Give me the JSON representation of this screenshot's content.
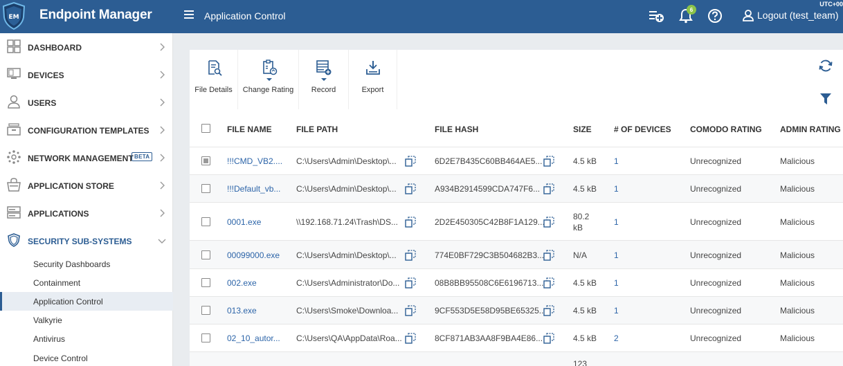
{
  "header": {
    "app_title": "Endpoint Manager",
    "logo_text": "EM",
    "page_title": "Application Control",
    "utc_label": "UTC+00",
    "notification_count": "6",
    "logout_label": "Logout (test_team)"
  },
  "sidebar": {
    "items": [
      {
        "label": "DASHBOARD",
        "icon": "dashboard-icon"
      },
      {
        "label": "DEVICES",
        "icon": "devices-icon"
      },
      {
        "label": "USERS",
        "icon": "users-icon"
      },
      {
        "label": "CONFIGURATION TEMPLATES",
        "icon": "templates-icon"
      },
      {
        "label": "NETWORK MANAGEMENT",
        "icon": "network-icon",
        "badge": "BETA"
      },
      {
        "label": "APPLICATION STORE",
        "icon": "store-icon"
      },
      {
        "label": "APPLICATIONS",
        "icon": "applications-icon"
      },
      {
        "label": "SECURITY SUB-SYSTEMS",
        "icon": "shield-icon",
        "expanded": true
      }
    ],
    "sub_items": [
      {
        "label": "Security Dashboards"
      },
      {
        "label": "Containment"
      },
      {
        "label": "Application Control",
        "active": true
      },
      {
        "label": "Valkyrie"
      },
      {
        "label": "Antivirus"
      },
      {
        "label": "Device Control"
      }
    ]
  },
  "toolbar": {
    "file_details": "File Details",
    "change_rating": "Change Rating",
    "record": "Record",
    "export": "Export"
  },
  "table": {
    "columns": [
      "FILE NAME",
      "FILE PATH",
      "FILE HASH",
      "SIZE",
      "# OF DEVICES",
      "COMODO RATING",
      "ADMIN RATING"
    ],
    "rows": [
      {
        "name": "!!!CMD_VB2....",
        "path": "C:\\Users\\Admin\\Desktop\\...",
        "hash": "6D2E7B435C60BB464AE5...",
        "size": "4.5 kB",
        "devices": "1",
        "comodo": "Unrecognized",
        "admin": "Malicious"
      },
      {
        "name": "!!!Default_vb...",
        "path": "C:\\Users\\Admin\\Desktop\\...",
        "hash": "A934B2914599CDA747F6...",
        "size": "4.5 kB",
        "devices": "1",
        "comodo": "Unrecognized",
        "admin": "Malicious"
      },
      {
        "name": "0001.exe",
        "path": "\\\\192.168.71.24\\Trash\\DS...",
        "hash": "2D2E450305C42B8F1A129...",
        "size": "80.2 kB",
        "devices": "1",
        "comodo": "Unrecognized",
        "admin": "Malicious"
      },
      {
        "name": "00099000.exe",
        "path": "C:\\Users\\Admin\\Desktop\\...",
        "hash": "774E0BF729C3B504682B3...",
        "size": "N/A",
        "devices": "1",
        "comodo": "Unrecognized",
        "admin": "Malicious"
      },
      {
        "name": "002.exe",
        "path": "C:\\Users\\Administrator\\Do...",
        "hash": "08B8BB95508C6E6196713...",
        "size": "4.5 kB",
        "devices": "1",
        "comodo": "Unrecognized",
        "admin": "Malicious"
      },
      {
        "name": "013.exe",
        "path": "C:\\Users\\Smoke\\Downloa...",
        "hash": "9CF553D5E58D95BE65325...",
        "size": "4.5 kB",
        "devices": "1",
        "comodo": "Unrecognized",
        "admin": "Malicious"
      },
      {
        "name": "02_10_autor...",
        "path": "C:\\Users\\QA\\AppData\\Roa...",
        "hash": "8CF871AB3AA8F9BA4E86...",
        "size": "4.5 kB",
        "devices": "2",
        "comodo": "Unrecognized",
        "admin": "Malicious"
      }
    ],
    "partial_row_size": "123"
  },
  "colors": {
    "brand": "#2c5d93",
    "link": "#2c64a8",
    "badge": "#8bc34a"
  }
}
